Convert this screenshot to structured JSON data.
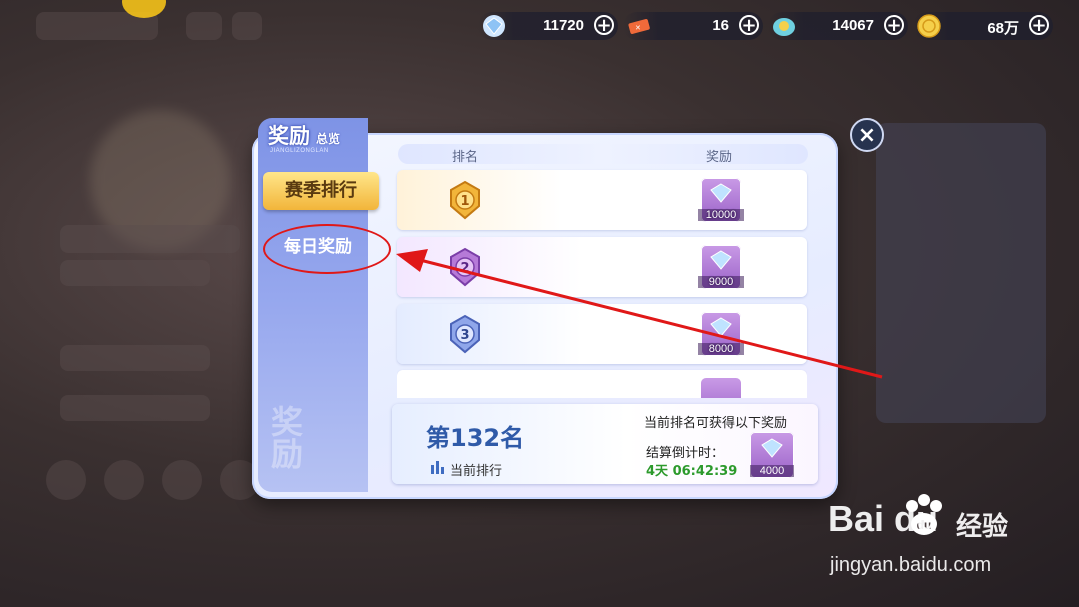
{
  "currencies": [
    {
      "icon": "diamond-icon",
      "value": "11720",
      "plus": "+"
    },
    {
      "icon": "ticket-icon",
      "value": "16",
      "plus": "+"
    },
    {
      "icon": "coin-blue-icon",
      "value": "14067",
      "plus": "+"
    },
    {
      "icon": "gold-coin-icon",
      "value": "68万",
      "plus": "+"
    }
  ],
  "panel": {
    "title_big": "奖励",
    "title_small": "总览",
    "title_pinyin": "JIANGLIZONGLAN",
    "tabs": {
      "season": "赛季排行",
      "daily": "每日奖励"
    },
    "side_watermark": "奖励",
    "columns": {
      "rank": "排名",
      "reward": "奖励"
    },
    "rows": [
      {
        "rank": "1",
        "reward": "10000"
      },
      {
        "rank": "2",
        "reward": "9000"
      },
      {
        "rank": "3",
        "reward": "8000"
      }
    ],
    "my": {
      "rank": "第132名",
      "rank_label": "当前排行",
      "reward_title": "当前排名可获得以下奖励",
      "countdown_label": "结算倒计时：",
      "countdown": "4天 06:42:39",
      "reward": "4000"
    },
    "close": "×"
  },
  "watermark": {
    "brand": "Bai  du",
    "cn": "经验",
    "url": "jingyan.baidu.com"
  },
  "colors": {
    "accent_gold": "#f2b53a",
    "side_blue": "#7e93e6",
    "annotation": "#e01818",
    "countdown": "#2c9a2c"
  }
}
